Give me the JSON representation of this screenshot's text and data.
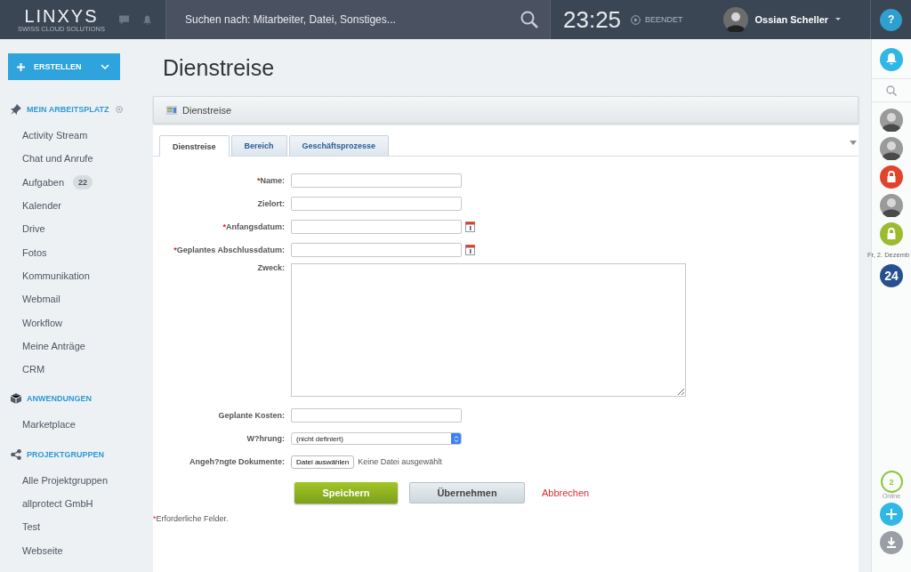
{
  "header": {
    "logo": "LINXYS",
    "logo_tagline": "SWISS CLOUD SOLUTIONS",
    "search": {
      "placeholder": "Suchen nach: Mitarbeiter, Datei, Sonstiges..."
    },
    "clock": "23:25",
    "timer_status": "BEENDET",
    "user": "Ossian Scheller",
    "help": "?"
  },
  "sidebar": {
    "create_button": "ERSTELLEN",
    "sections": [
      {
        "title": "MEIN ARBEITSPLATZ",
        "kind": "pin",
        "settings": true,
        "items": [
          {
            "label": "Activity Stream"
          },
          {
            "label": "Chat und Anrufe"
          },
          {
            "label": "Aufgaben",
            "badge": "22"
          },
          {
            "label": "Kalender"
          },
          {
            "label": "Drive"
          },
          {
            "label": "Fotos"
          },
          {
            "label": "Kommunikation"
          },
          {
            "label": "Webmail"
          },
          {
            "label": "Workflow"
          },
          {
            "label": "Meine Anträge"
          },
          {
            "label": "CRM"
          }
        ]
      },
      {
        "title": "ANWENDUNGEN",
        "kind": "box",
        "settings": false,
        "items": [
          {
            "label": "Marketplace"
          }
        ]
      },
      {
        "title": "PROJEKTGRUPPEN",
        "kind": "share",
        "settings": false,
        "items": [
          {
            "label": "Alle Projektgruppen"
          },
          {
            "label": "allprotect GmbH"
          },
          {
            "label": "Test"
          },
          {
            "label": "Webseite"
          }
        ]
      }
    ]
  },
  "page_title": "Dienstreise",
  "panel": {
    "title": "Dienstreise",
    "tabs": [
      {
        "label": "Dienstreise",
        "selected": true
      },
      {
        "label": "Bereich",
        "selected": false
      },
      {
        "label": "Geschäftsprozesse",
        "selected": false
      }
    ],
    "fields": [
      {
        "label": "Name:",
        "kind": "text",
        "required": true
      },
      {
        "label": "Zielort:",
        "kind": "text",
        "required": false
      },
      {
        "label": "Anfangsdatum:",
        "kind": "date",
        "required": true
      },
      {
        "label": "Geplantes Abschlussdatum:",
        "kind": "date",
        "required": true
      },
      {
        "label": "Zweck:",
        "kind": "textarea",
        "required": false
      },
      {
        "label": "Geplante Kosten:",
        "kind": "text",
        "required": false
      },
      {
        "label": "W?hrung:",
        "kind": "select",
        "required": false,
        "value": "(nicht definiert)"
      },
      {
        "label": "Angeh?ngte Dokumente:",
        "kind": "file",
        "required": false,
        "button": "Datei auswählen",
        "value": "Keine Datei ausgewählt"
      }
    ],
    "buttons": [
      {
        "label": "Speichern",
        "kind": "primary"
      },
      {
        "label": "Übernehmen",
        "kind": "secondary"
      },
      {
        "label": "Abbrechen",
        "kind": "link"
      }
    ],
    "required_mark": "*",
    "footnote": "Erforderliche Felder."
  },
  "rail": {
    "items": [
      {
        "kind": "avatar"
      },
      {
        "kind": "avatar"
      },
      {
        "kind": "lock",
        "color": "#e0452b"
      },
      {
        "kind": "avatar"
      },
      {
        "kind": "lock",
        "color": "#9dbb2f"
      }
    ],
    "date": "Fr, 2. Dezemb",
    "day": "24",
    "online_count": "2",
    "online_label": "Online"
  }
}
